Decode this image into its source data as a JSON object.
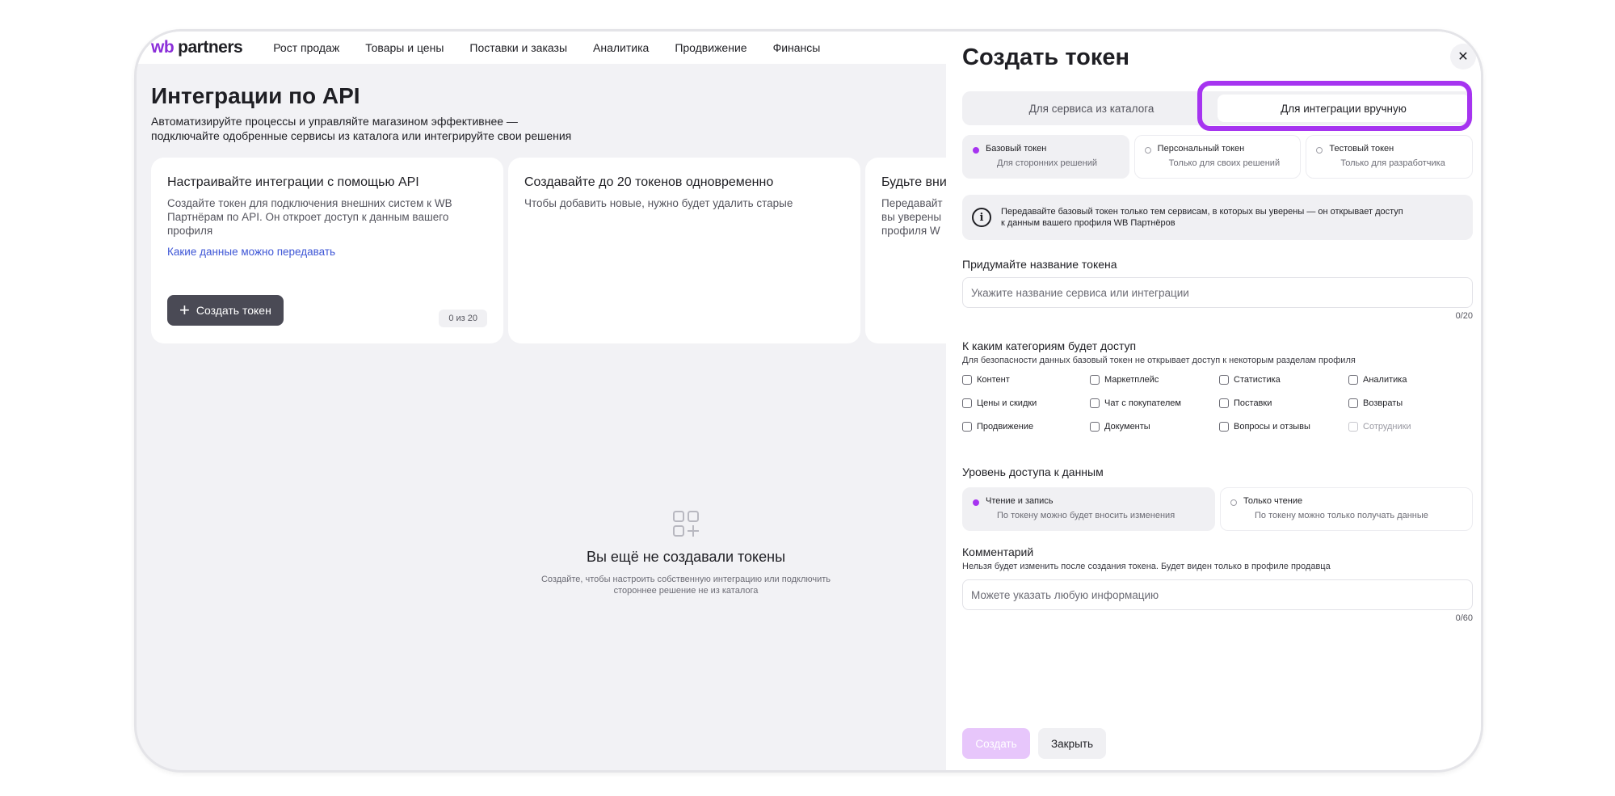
{
  "nav": {
    "logo_wb": "wb",
    "logo_partners": "partners",
    "items": [
      "Рост продаж",
      "Товары и цены",
      "Поставки и заказы",
      "Аналитика",
      "Продвижение",
      "Финансы"
    ]
  },
  "main": {
    "title": "Интеграции по API",
    "subtitle_line1": "Автоматизируйте процессы и управляйте магазином эффективнее —",
    "subtitle_line2": "подключайте одобренные сервисы из каталога или интегрируйте свои решения",
    "cards": [
      {
        "title": "Настраивайте интеграции с помощью API",
        "text": "Создайте токен для подключения внешних систем к WB Партнёрам по API. Он откроет доступ к данным вашего профиля",
        "link": "Какие данные можно передавать",
        "button": "Создать токен",
        "counter": "0 из 20"
      },
      {
        "title": "Создавайте до 20 токенов одновременно",
        "text": "Чтобы добавить новые, нужно будет удалить старые"
      },
      {
        "title": "Будьте вни",
        "text": "Передавайт вы уверены профиля W"
      }
    ],
    "empty": {
      "title": "Вы ещё не создавали токены",
      "text_line1": "Создайте, чтобы настроить собственную интеграцию или подключить",
      "text_line2": "стороннее решение не из каталога"
    }
  },
  "panel": {
    "title": "Создать токен",
    "close": "✕",
    "tabs": [
      "Для сервиса из каталога",
      "Для интеграции вручную"
    ],
    "token_types": [
      {
        "title": "Базовый токен",
        "sub": "Для сторонних решений",
        "active": true
      },
      {
        "title": "Персональный токен",
        "sub": "Только для своих решений",
        "active": false
      },
      {
        "title": "Тестовый токен",
        "sub": "Только для разработчика",
        "active": false
      }
    ],
    "info_icon": "i",
    "info_text_line1": "Передавайте базовый токен только тем сервисам, в которых вы уверены — он открывает доступ",
    "info_text_line2": "к данным вашего профиля WB Партнёров",
    "name_label": "Придумайте название токена",
    "name_placeholder": "Укажите название сервиса или интеграции",
    "name_counter": "0/20",
    "categories_label": "К каким категориям будет доступ",
    "categories_sub": "Для безопасности данных базовый токен не открывает доступ к некоторым разделам профиля",
    "categories": [
      "Контент",
      "Маркетплейс",
      "Статистика",
      "Аналитика",
      "Цены и скидки",
      "Чат с покупателем",
      "Поставки",
      "Возвраты",
      "Продвижение",
      "Документы",
      "Вопросы и отзывы",
      "Сотрудники"
    ],
    "access_label": "Уровень доступа к данным",
    "access_levels": [
      {
        "title": "Чтение и запись",
        "sub": "По токену можно будет вносить изменения",
        "active": true
      },
      {
        "title": "Только чтение",
        "sub": "По токену можно только получать данные",
        "active": false
      }
    ],
    "comment_label": "Комментарий",
    "comment_sub": "Нельзя будет изменить после создания токена. Будет виден только в профиле продавца",
    "comment_placeholder": "Можете указать любую информацию",
    "comment_counter": "0/60",
    "submit": "Создать",
    "cancel": "Закрыть"
  },
  "colors": {
    "accent": "#a634f0",
    "brand": "#8b2fd9",
    "link": "#3e56d6",
    "disabled_primary": "#e7c6fb"
  }
}
